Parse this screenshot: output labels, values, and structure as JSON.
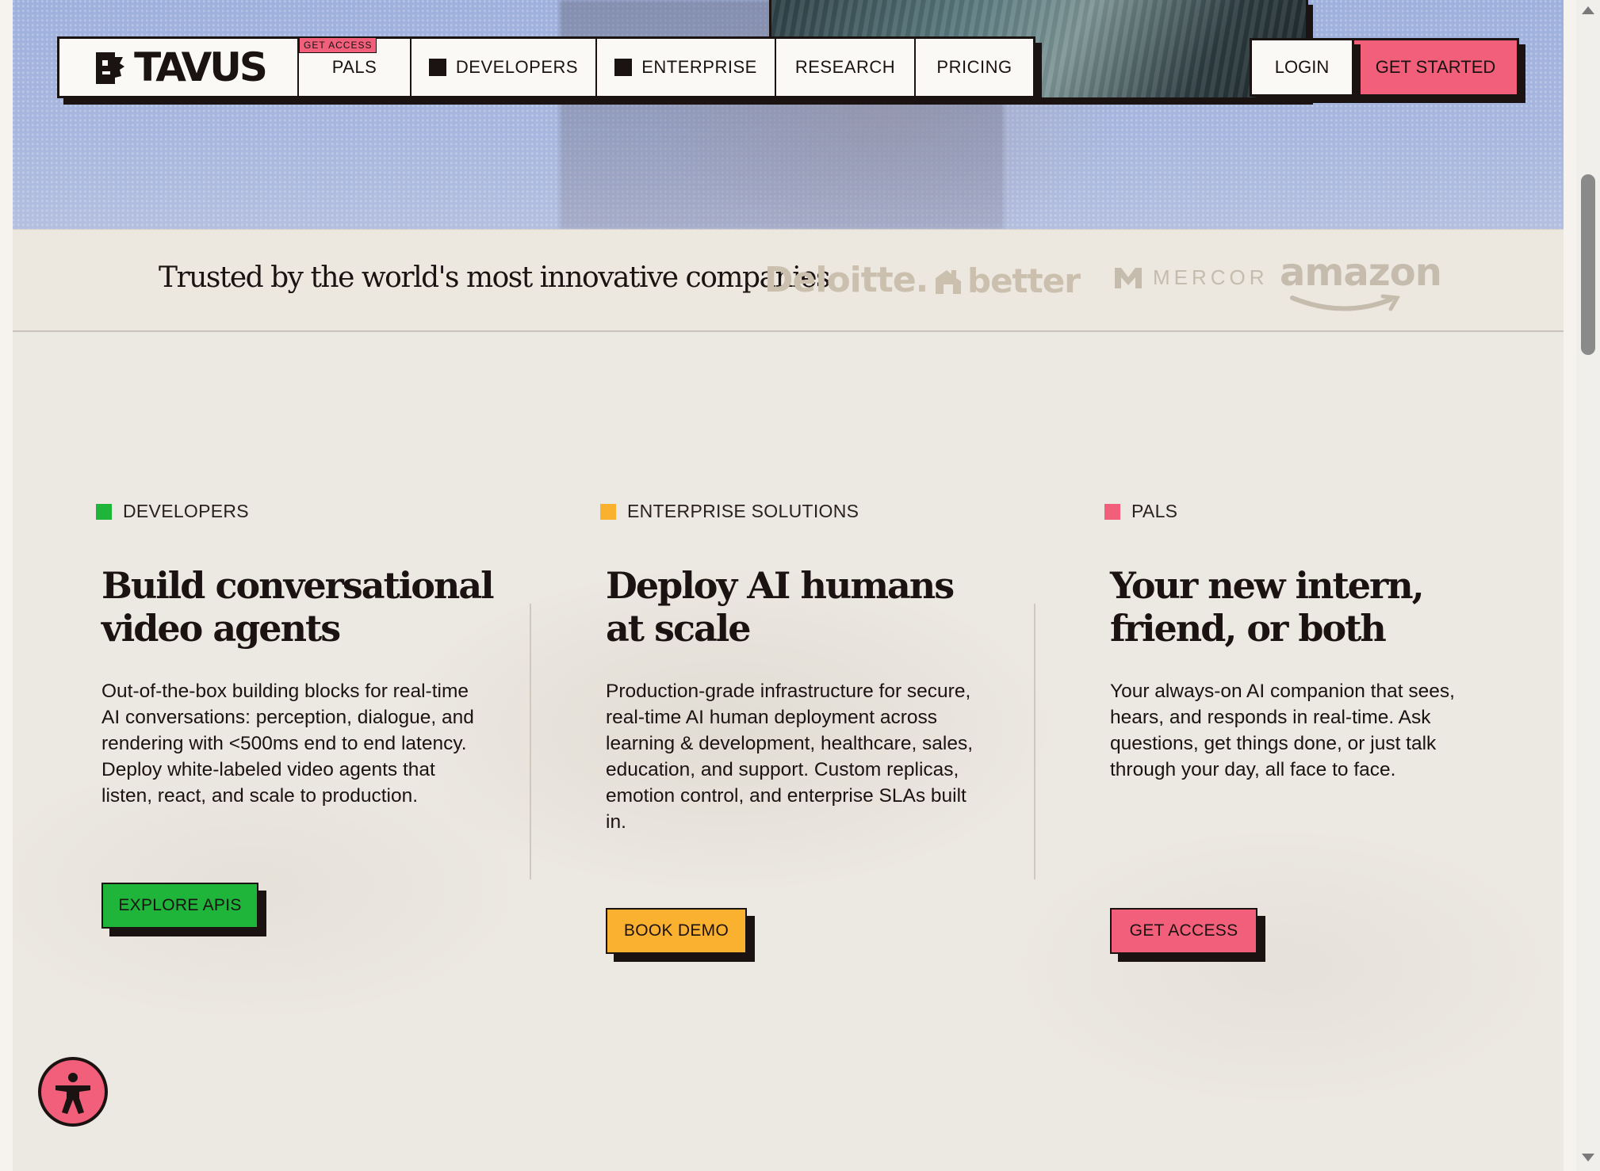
{
  "nav": {
    "logo_text": "TAVUS",
    "items": [
      {
        "label": "PALS",
        "badge": "GET ACCESS"
      },
      {
        "label": "DEVELOPERS"
      },
      {
        "label": "ENTERPRISE"
      },
      {
        "label": "RESEARCH"
      },
      {
        "label": "PRICING"
      }
    ],
    "login_label": "LOGIN",
    "get_started_label": "GET STARTED"
  },
  "trusted": {
    "heading": "Trusted by the world's most innovative companies",
    "logos": [
      "Deloitte.",
      "better",
      "MERCOR",
      "amazon"
    ]
  },
  "columns": [
    {
      "label": "DEVELOPERS",
      "color": "#1eb53a",
      "title_line1": "Build conversational",
      "title_line2": "video agents",
      "body": "Out-of-the-box building blocks for real-time AI conversations: perception, dialogue, and rendering with <500ms end to end latency. Deploy white-labeled video agents that listen, react, and scale to production.",
      "cta": "EXPLORE APIS"
    },
    {
      "label": "ENTERPRISE SOLUTIONS",
      "color": "#fbb130",
      "title_line1": "Deploy AI humans",
      "title_line2": "at scale",
      "body": "Production-grade infrastructure for secure, real-time AI human deployment across learning & development, healthcare, sales, education, and support. Custom replicas, emotion control, and enterprise SLAs built in.",
      "cta": "BOOK DEMO"
    },
    {
      "label": "PALS",
      "color": "#f25f7a",
      "title_line1": "Your new intern,",
      "title_line2": "friend, or both",
      "body": "Your always-on AI companion that sees, hears, and responds in real-time. Ask questions, get things done, or just talk through your day, all face to face.",
      "cta": "GET ACCESS"
    }
  ],
  "icons": {
    "accessibility": "accessibility-icon",
    "logo": "tavus-logo-icon"
  },
  "colors": {
    "accent_pink": "#f25f7a",
    "green": "#1eb53a",
    "amber": "#fbb130",
    "ink": "#1b1212"
  }
}
